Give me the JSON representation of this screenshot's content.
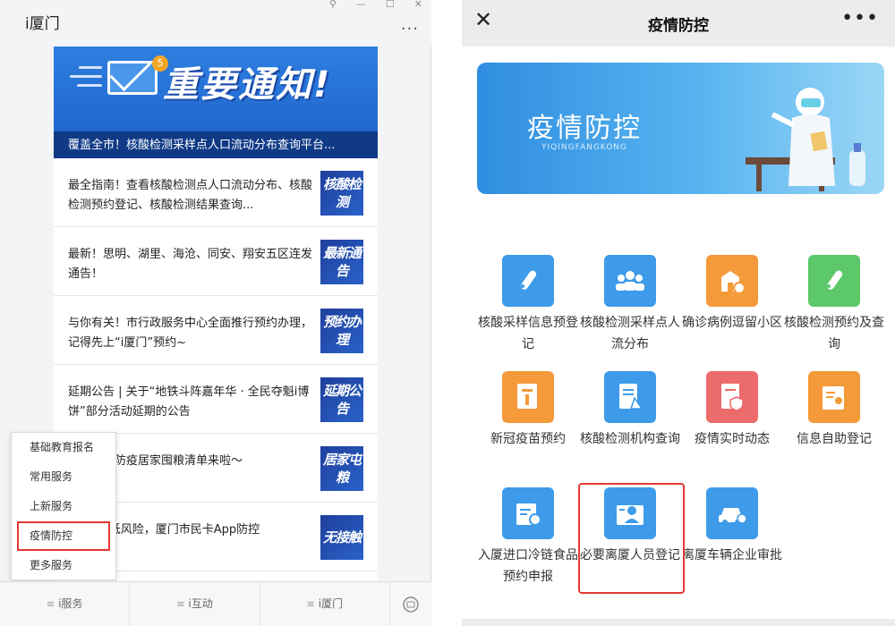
{
  "left": {
    "title": "i厦门",
    "more_icon": "more-horizontal-icon",
    "banner": {
      "badge": "5",
      "heading": "重要通知!",
      "caption": "覆盖全市！核酸检测采样点人口流动分布查询平台..."
    },
    "news": [
      {
        "text": "最全指南！查看核酸检测点人口流动分布、核酸检测预约登记、核酸检测结果查询...",
        "thumb": "核酸检测"
      },
      {
        "text": "最新！思明、湖里、海沧、同安、翔安五区连发通告！",
        "thumb": "最新通告"
      },
      {
        "text": "与你有关！市行政服务中心全面推行预约办理，记得先上“i厦门”预约~",
        "thumb": "预约办理"
      },
      {
        "text": "延期公告 | 关于“地铁斗阵嘉年华 · 全民夺魁i博饼”部分活动延期的公告",
        "thumb": "延期公告"
      },
      {
        "text": "厦门市民防疫居家囤粮清单来啦～",
        "thumb": "居家屯粮"
      },
      {
        "text": "“乘车降低风险，厦门市民卡App防控",
        "thumb": "无接触"
      }
    ],
    "popup_menu": [
      "基础教育报名",
      "常用服务",
      "上新服务",
      "疫情防控",
      "更多服务"
    ],
    "popup_selected": "疫情防控",
    "tabs": [
      "i服务",
      "i互动",
      "i厦门"
    ],
    "keyboard_icon": "keyboard-icon"
  },
  "right": {
    "title": "疫情防控",
    "close_icon": "close-icon",
    "more_icon": "more-horizontal-icon",
    "hero": {
      "title": "疫情防控",
      "subtitle": "YIQINGFANGKONG"
    },
    "services": [
      {
        "label": "核酸采样信息预登记",
        "icon": "test-tube-icon",
        "color": "#3d9be9"
      },
      {
        "label": "核酸检测采样点人流分布",
        "icon": "people-icon",
        "color": "#3d9be9"
      },
      {
        "label": "确诊病例逗留小区",
        "icon": "building-icon",
        "color": "#f59a3a"
      },
      {
        "label": "核酸检测预约及查询",
        "icon": "test-tube-icon",
        "color": "#5cc86a"
      },
      {
        "label": "新冠疫苗预约",
        "icon": "vaccine-doc-icon",
        "color": "#f59a3a"
      },
      {
        "label": "核酸检测机构查询",
        "icon": "document-flask-icon",
        "color": "#3d9be9"
      },
      {
        "label": "疫情实时动态",
        "icon": "shield-doc-icon",
        "color": "#ec6b6b"
      },
      {
        "label": "信息自助登记",
        "icon": "id-card-icon",
        "color": "#f59a3a"
      },
      {
        "label": "入厦进口冷链食品预约申报",
        "icon": "calendar-icon",
        "color": "#3d9be9"
      },
      {
        "label": "必要离厦人员登记",
        "icon": "person-card-icon",
        "color": "#3d9be9"
      },
      {
        "label": "离厦车辆企业审批",
        "icon": "car-icon",
        "color": "#3d9be9"
      }
    ]
  }
}
